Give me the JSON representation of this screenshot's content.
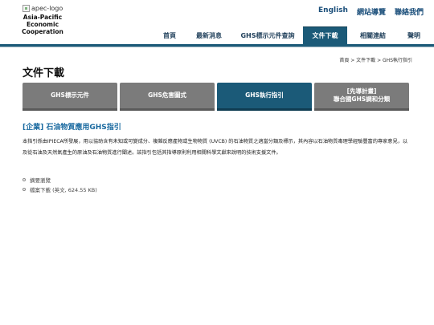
{
  "header": {
    "logo_alt": "apec-logo",
    "logo_line1": "Asia-Pacific",
    "logo_line2": "Economic Cooperation",
    "util_links": [
      "English",
      "網站導覽",
      "聯絡我們"
    ]
  },
  "nav": {
    "items": [
      "首頁",
      "最新消息",
      "GHS標示元件查詢",
      "文件下載",
      "相關連結",
      "聲明"
    ],
    "active_index": 3
  },
  "breadcrumb": "首頁 > 文件下載 > GHS執行指引",
  "page_title": "文件下載",
  "tabs": [
    {
      "line1": "GHS標示元件",
      "line2": ""
    },
    {
      "line1": "GHS危害圖式",
      "line2": ""
    },
    {
      "line1": "GHS執行指引",
      "line2": ""
    },
    {
      "line1": "[先導計畫]",
      "line2": "聯合國GHS調和分類"
    }
  ],
  "active_tab": 2,
  "section_title": "[企業] 石油物質應用GHS指引",
  "description": "本指引係由IPIECA所發展，用以協助含有未知或可變成分、複雜反應產物或生物物質 (UVCB) 的石油物質之適當分類及標示，其內容以石油物質毒理學經驗豐富的專家意見，以及從石油及天然氣產生的原油及石油物質進行闡述。該指引包括其指導原則利用相關科學文獻來說明的技術支援文件。",
  "links": [
    "摘要瀏覽",
    "檔案下載 (英文, 624.55 KB)"
  ],
  "colors": {
    "accent": "#1b5a78",
    "tab_inactive": "#7b7b7b",
    "section_title": "#1a6aa0"
  }
}
